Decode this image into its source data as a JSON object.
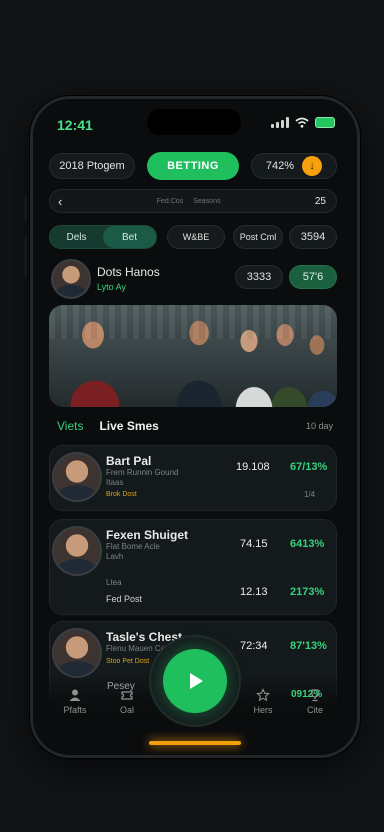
{
  "status_bar": {
    "time": "12:41"
  },
  "top_bar": {
    "left_label": "2018 Ptogem",
    "center_label": "BETTING",
    "right_value": "742%"
  },
  "search_bar": {
    "back": "‹",
    "hint_a": "Fed.Cos",
    "hint_b": "Seasons",
    "count": "25"
  },
  "filters": {
    "tab1": "Dels",
    "tab2": "Bet",
    "chip1": "W&BE",
    "chip2": "Post Cml",
    "chip3": "3594"
  },
  "featured": {
    "name": "Dots Hanos",
    "status": "Lyto Ay",
    "stat1": "3333",
    "stat2": "57'6"
  },
  "section": {
    "tab_active": "Viets",
    "tab_title": "Live Smes",
    "range": "10 day"
  },
  "players": [
    {
      "name": "Bart Pal",
      "sub": "Frem Runnin Gound",
      "sub2": "Itaas",
      "tag": "Brok Dost",
      "value": "19.108",
      "pct": "67/13%",
      "value2": "",
      "pct2": "1/4"
    },
    {
      "name": "Fexen Shuiget",
      "sub": "Flat Bome Acle",
      "sub2": "Lavh",
      "tag": "",
      "extra_a": "Ltea",
      "extra_b": "Fed Post",
      "value": "74.15",
      "pct": "6413%",
      "value2": "12.13",
      "pct2": "2173%"
    },
    {
      "name": "Tasle's Chest",
      "sub": "Flenu Mauen Cahro",
      "sub2": "",
      "tag": "Stoo Pet Dost",
      "value": "72:34",
      "pct": "87'13%",
      "value2": "",
      "pct2": ""
    }
  ],
  "bottom_nav": [
    {
      "label": "Pfafts",
      "icon": "user-icon"
    },
    {
      "label": "Oal",
      "icon": "ticket-icon"
    },
    {
      "label": "Pesey",
      "icon": "card-icon"
    },
    {
      "label": "Hers",
      "icon": "star-icon"
    },
    {
      "label": "Cite",
      "icon": "trophy-icon"
    }
  ],
  "extra_pct": "0912%",
  "colors": {
    "accent": "#1fbf5d",
    "bg": "#0a0c0d",
    "highlight": "#f59e0b"
  }
}
